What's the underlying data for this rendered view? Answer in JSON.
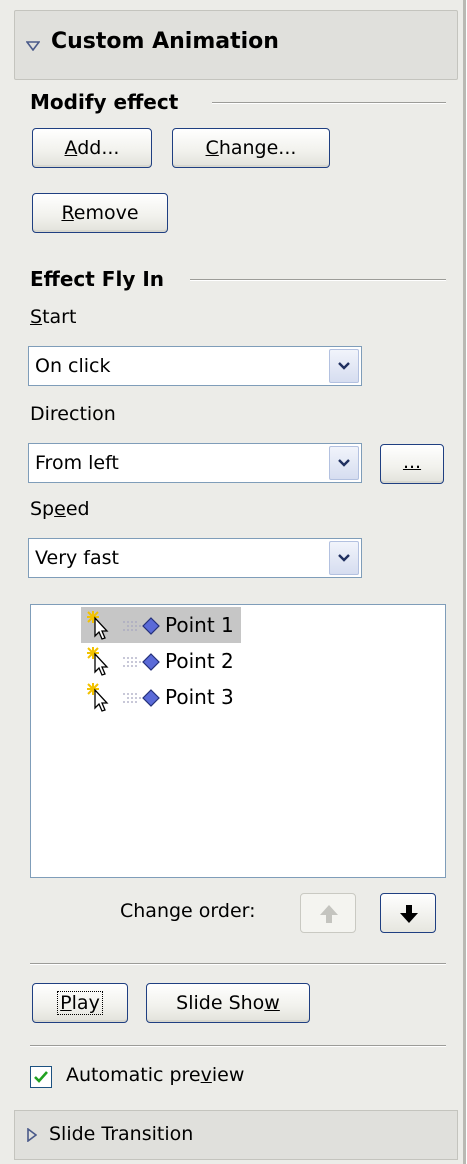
{
  "panel": {
    "title": "Custom Animation"
  },
  "modify": {
    "section_title": "Modify effect",
    "add_label": "Add...",
    "change_label": "Change...",
    "remove_label": "Remove"
  },
  "effect": {
    "section_title": "Effect Fly In",
    "start_label": "Start",
    "start_value": "On click",
    "direction_label": "Direction",
    "direction_value": "From left",
    "options_label": "...",
    "speed_label": "Speed",
    "speed_value": "Very fast"
  },
  "list": {
    "items": [
      {
        "label": "Point 1",
        "selected": true
      },
      {
        "label": "Point 2",
        "selected": false
      },
      {
        "label": "Point 3",
        "selected": false
      }
    ]
  },
  "order": {
    "label": "Change order:"
  },
  "actions": {
    "play_label": "Play",
    "slideshow_label": "Slide Show"
  },
  "preview": {
    "label": "Automatic preview",
    "checked": true
  },
  "footer": {
    "title": "Slide Transition"
  }
}
